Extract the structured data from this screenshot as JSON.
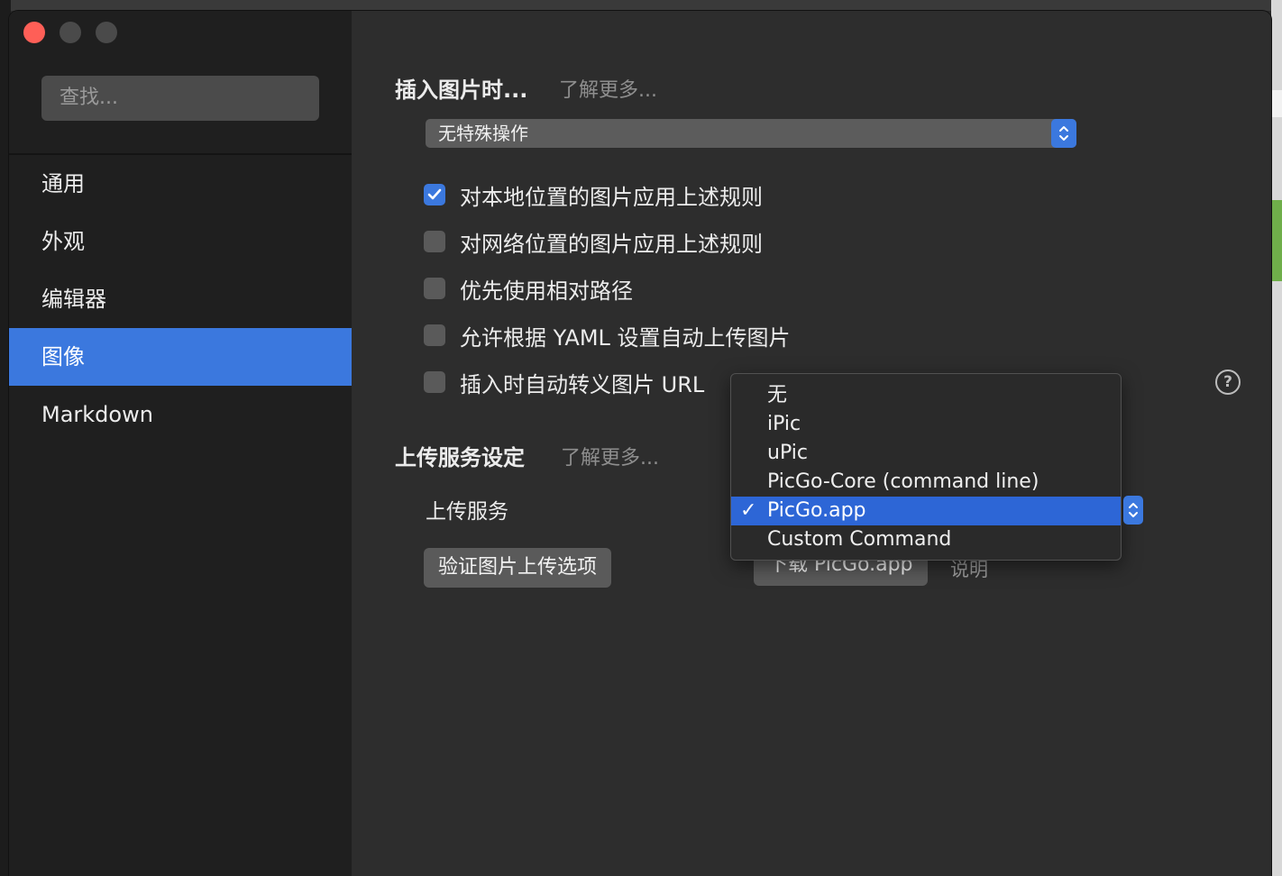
{
  "sidebar": {
    "search_placeholder": "查找...",
    "items": [
      {
        "label": "通用"
      },
      {
        "label": "外观"
      },
      {
        "label": "编辑器"
      },
      {
        "label": "图像",
        "active": true
      },
      {
        "label": "Markdown"
      }
    ]
  },
  "image_section": {
    "title": "插入图片时...",
    "learn_more": "了解更多...",
    "insert_action": "无特殊操作",
    "checkboxes": [
      {
        "label": "对本地位置的图片应用上述规则",
        "checked": true
      },
      {
        "label": "对网络位置的图片应用上述规则",
        "checked": false
      },
      {
        "label": "优先使用相对路径",
        "checked": false
      },
      {
        "label": "允许根据 YAML 设置自动上传图片",
        "checked": false
      },
      {
        "label": "插入时自动转义图片 URL",
        "checked": false
      }
    ],
    "help_icon": "?"
  },
  "upload_section": {
    "title": "上传服务设定",
    "learn_more": "了解更多...",
    "service_label": "上传服务",
    "verify_button": "验证图片上传选项",
    "download_button": "下载 PicGo.app",
    "help_link": "说明"
  },
  "dropdown": {
    "options": [
      "无",
      "iPic",
      "uPic",
      "PicGo-Core (command line)",
      "PicGo.app",
      "Custom Command"
    ],
    "selected": "PicGo.app",
    "check_mark": "✓"
  },
  "colors": {
    "accent": "#3b78de",
    "close_button": "#fe5f57",
    "sidebar_bg": "#1f1f1f",
    "main_bg": "#2d2d2d"
  }
}
